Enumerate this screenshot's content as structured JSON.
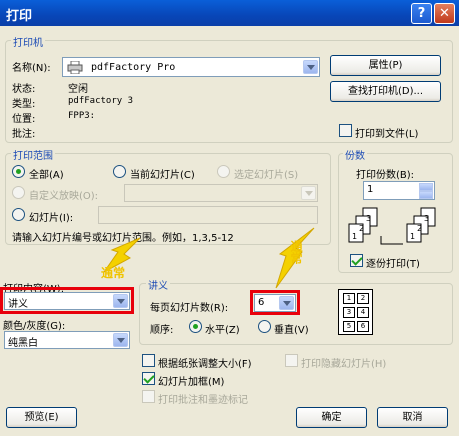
{
  "window": {
    "title": "打印",
    "help_glyph": "?",
    "close_glyph": "✕"
  },
  "printer": {
    "group_title": "打印机",
    "name_label": "名称(N):",
    "name_value": "pdfFactory Pro",
    "status_label": "状态:",
    "status_value": "空闲",
    "type_label": "类型:",
    "type_value": "pdfFactory 3",
    "location_label": "位置:",
    "location_value": "FPP3:",
    "comment_label": "批注:",
    "comment_value": "",
    "properties_button": "属性(P)",
    "find_printer_button": "查找打印机(D)...",
    "print_to_file_label": "打印到文件(L)",
    "print_to_file_checked": false
  },
  "print_range": {
    "group_title": "打印范围",
    "all_label": "全部(A)",
    "current_slide_label": "当前幻灯片(C)",
    "selection_label": "选定幻灯片(S)",
    "custom_show_label": "自定义放映(O):",
    "custom_show_value": "",
    "slides_label": "幻灯片(I):",
    "slides_value": "",
    "hint": "请输入幻灯片编号或幻灯片范围。例如，1,3,5-12",
    "selected": "all"
  },
  "copies": {
    "group_title": "份数",
    "number_label": "打印份数(B):",
    "number_value": "1",
    "collate_label": "逐份打印(T)",
    "collate_checked": true,
    "collate_illustration": [
      "1",
      "2",
      "3"
    ]
  },
  "print_what": {
    "label": "打印内容(W):",
    "value": "讲义",
    "annotation": "通常"
  },
  "color": {
    "label": "颜色/灰度(G):",
    "value": "纯黑白"
  },
  "handouts": {
    "group_title": "讲义",
    "per_page_label": "每页幻灯片数(R):",
    "per_page_value": "6",
    "annotation": "通常",
    "order_label": "顺序:",
    "horizontal_label": "水平(Z)",
    "vertical_label": "垂直(V)",
    "order_selected": "horizontal",
    "preview_cells": [
      "1",
      "2",
      "3",
      "4",
      "5",
      "6"
    ]
  },
  "options": {
    "scale_to_fit_label": "根据纸张调整大小(F)",
    "scale_to_fit_checked": false,
    "print_hidden_label": "打印隐藏幻灯片(H)",
    "print_hidden_checked": false,
    "frame_slides_label": "幻灯片加框(M)",
    "frame_slides_checked": true,
    "print_comments_label": "打印批注和墨迹标记",
    "print_comments_checked": false
  },
  "footer": {
    "preview_button": "预览(E)",
    "ok_button": "确定",
    "cancel_button": "取消"
  }
}
